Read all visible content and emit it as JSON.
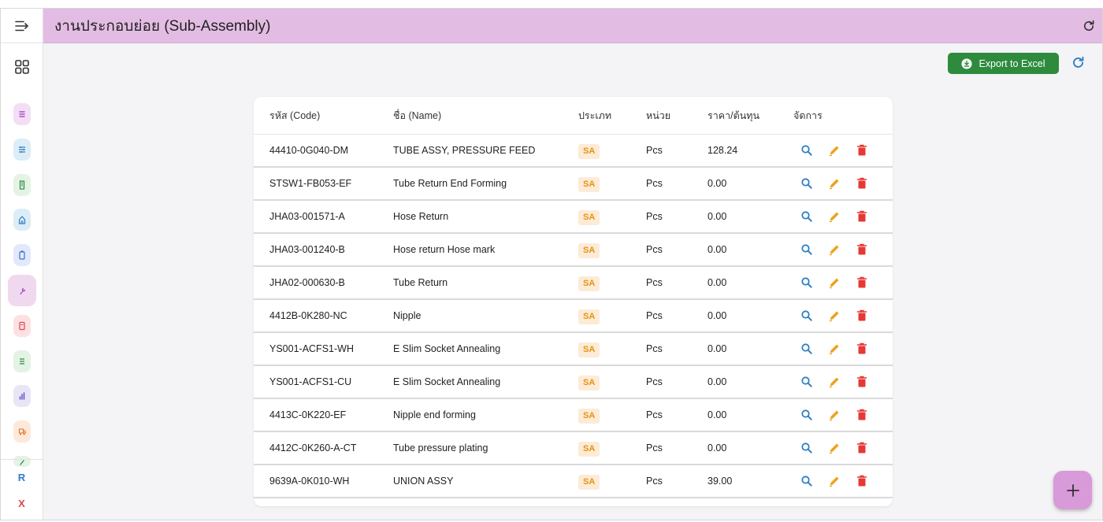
{
  "header": {
    "title": "งานประกอบย่อย (Sub-Assembly)"
  },
  "toolbar": {
    "export_label": "Export to Excel"
  },
  "sidebar": {
    "items": [
      {
        "icon": "list-icon",
        "color": "#b04cc9",
        "bg": "#f3dff5"
      },
      {
        "icon": "sliders-icon",
        "color": "#2f7fc1",
        "bg": "#dcedf8"
      },
      {
        "icon": "building-icon",
        "color": "#2e8b3e",
        "bg": "#e4f3e6"
      },
      {
        "icon": "home-icon",
        "color": "#2f7fc1",
        "bg": "#dcedf8"
      },
      {
        "icon": "clipboard-icon",
        "color": "#3d6fd6",
        "bg": "#e1e9fa"
      },
      {
        "icon": "wrench-icon",
        "color": "#b04cc9",
        "bg": "#f0d9ef"
      },
      {
        "icon": "document-icon",
        "color": "#e0454c",
        "bg": "#fbe1e2"
      },
      {
        "icon": "checklist-icon",
        "color": "#2e8b3e",
        "bg": "#e4f3e6"
      },
      {
        "icon": "bar-chart-icon",
        "color": "#5b4bc4",
        "bg": "#e8e5f7"
      },
      {
        "icon": "truck-icon",
        "color": "#e8731d",
        "bg": "#fde9db"
      },
      {
        "icon": "tool-icon",
        "color": "#2e8b3e",
        "bg": "#e4f3e6"
      }
    ],
    "active_index": 5,
    "letters": [
      {
        "text": "R",
        "color": "#2f7fc1"
      },
      {
        "text": "X",
        "color": "#e0454c"
      }
    ]
  },
  "table": {
    "columns": [
      "รหัส (Code)",
      "ชื่อ (Name)",
      "ประเภท",
      "หน่วย",
      "ราคา/ต้นทุน",
      "จัดการ"
    ],
    "rows": [
      {
        "code": "44410-0G040-DM",
        "name": "TUBE ASSY, PRESSURE FEED",
        "type": "SA",
        "unit": "Pcs",
        "price": "128.24"
      },
      {
        "code": "STSW1-FB053-EF",
        "name": "Tube Return End Forming",
        "type": "SA",
        "unit": "Pcs",
        "price": "0.00"
      },
      {
        "code": "JHA03-001571-A",
        "name": "Hose Return",
        "type": "SA",
        "unit": "Pcs",
        "price": "0.00"
      },
      {
        "code": "JHA03-001240-B",
        "name": "Hose return Hose mark",
        "type": "SA",
        "unit": "Pcs",
        "price": "0.00"
      },
      {
        "code": "JHA02-000630-B",
        "name": "Tube Return",
        "type": "SA",
        "unit": "Pcs",
        "price": "0.00"
      },
      {
        "code": "4412B-0K280-NC",
        "name": "Nipple",
        "type": "SA",
        "unit": "Pcs",
        "price": "0.00"
      },
      {
        "code": "YS001-ACFS1-WH",
        "name": "E Slim Socket Annealing",
        "type": "SA",
        "unit": "Pcs",
        "price": "0.00"
      },
      {
        "code": "YS001-ACFS1-CU",
        "name": "E Slim Socket Annealing",
        "type": "SA",
        "unit": "Pcs",
        "price": "0.00"
      },
      {
        "code": "4413C-0K220-EF",
        "name": "Nipple end forming",
        "type": "SA",
        "unit": "Pcs",
        "price": "0.00"
      },
      {
        "code": "4412C-0K260-A-CT",
        "name": "Tube pressure plating",
        "type": "SA",
        "unit": "Pcs",
        "price": "0.00"
      },
      {
        "code": "9639A-0K010-WH",
        "name": "UNION ASSY",
        "type": "SA",
        "unit": "Pcs",
        "price": "39.00"
      }
    ]
  },
  "colors": {
    "header_bg": "#e3bce3",
    "export_bg": "#2e8b3e",
    "view": "#2f7fc1",
    "edit": "#f0a020",
    "delete": "#e53935",
    "badge_bg": "#fcebd7",
    "badge_text": "#e8930d",
    "fab_bg": "#d99ad9"
  }
}
